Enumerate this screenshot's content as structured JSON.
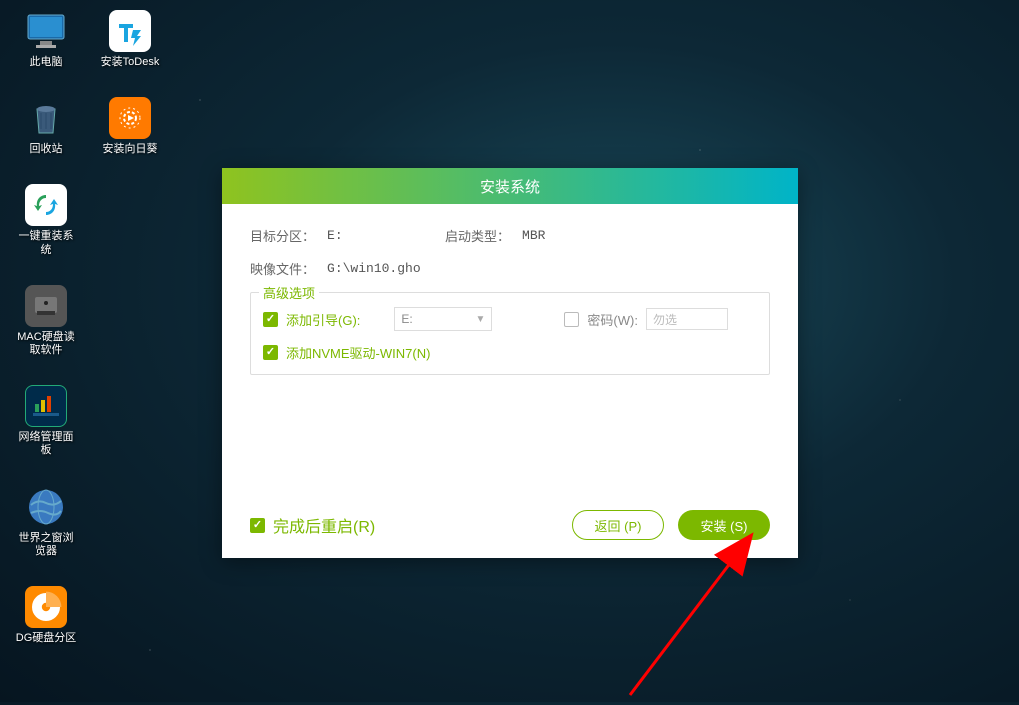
{
  "desktop": {
    "icons": [
      {
        "name": "this-pc",
        "label": "此电脑"
      },
      {
        "name": "install-todesk",
        "label": "安装ToDesk"
      },
      {
        "name": "recycle-bin",
        "label": "回收站"
      },
      {
        "name": "install-sunflower",
        "label": "安装向日葵"
      },
      {
        "name": "one-click-reinstall",
        "label": "一键重装系统"
      },
      {
        "name": "mac-disk-reader",
        "label": "MAC硬盘读取软件"
      },
      {
        "name": "network-panel",
        "label": "网络管理面板"
      },
      {
        "name": "theworld-browser",
        "label": "世界之窗浏览器"
      },
      {
        "name": "dg-partition",
        "label": "DG硬盘分区"
      }
    ]
  },
  "dialog": {
    "title": "安装系统",
    "target_partition_label": "目标分区：",
    "target_partition_value": "E:",
    "boot_type_label": "启动类型：",
    "boot_type_value": "MBR",
    "image_file_label": "映像文件：",
    "image_file_value": "G:\\win10.gho",
    "advanced": {
      "legend": "高级选项",
      "add_boot": {
        "checked": true,
        "label": "添加引导(G):",
        "value": "E:"
      },
      "password": {
        "checked": false,
        "label": "密码(W):",
        "placeholder": "勿选"
      },
      "add_nvme": {
        "checked": true,
        "label": "添加NVME驱动-WIN7(N)"
      }
    },
    "footer": {
      "restart_after": {
        "checked": true,
        "label": "完成后重启(R)"
      },
      "back_button": "返回 (P)",
      "install_button": "安装 (S)"
    }
  }
}
